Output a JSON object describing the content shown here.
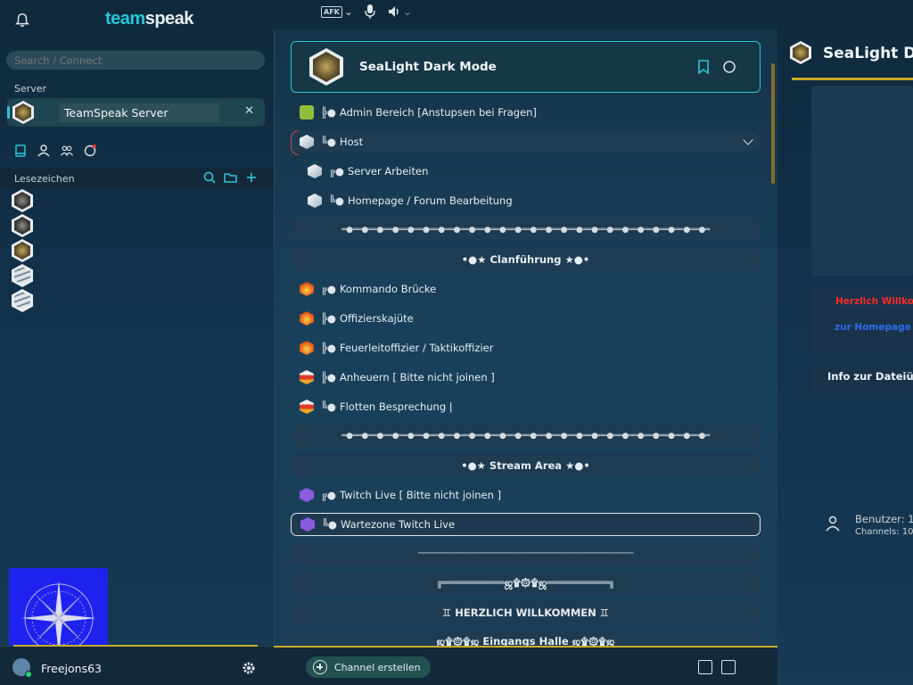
{
  "topbar": {
    "brand_part1": "team",
    "brand_part2": "speak",
    "afk_label": "AFK"
  },
  "sidebar": {
    "search_placeholder": "Search / Connect",
    "server_section_label": "Server",
    "active_server_name": "TeamSpeak Server",
    "bookmarks_label": "Lesezeichen",
    "bookmark_icons": [
      "server-logo",
      "server-logo",
      "server-logo-gold",
      "layers",
      "layers"
    ]
  },
  "user": {
    "nickname": "Freejons63",
    "status_color": "#25d366"
  },
  "server": {
    "title": "SeaLight Dark Mode",
    "accent_color": "#2ac6d8"
  },
  "channels": [
    {
      "icon": "help-badge",
      "prefix": "╠●",
      "name": "Admin Bereich [Anstupsen bei Fragen]"
    },
    {
      "icon": "cube",
      "prefix": "╚●",
      "name": "Host",
      "expanded": true
    },
    {
      "icon": "cube",
      "prefix": "╔●",
      "name": "Server Arbeiten",
      "sub": true
    },
    {
      "icon": "cube",
      "prefix": "╚●",
      "name": "Homepage / Forum Bearbeitung",
      "sub": true
    },
    {
      "spacer": "═●══●══●══●══●══●══●══●══●══●══●══●══●══●══●══●══●══●══●══●══●══●══●══●═"
    },
    {
      "header": "•●★ Clanführung ★●•"
    },
    {
      "icon": "fire",
      "prefix": "╔●",
      "name": "Kommando Brücke"
    },
    {
      "icon": "fire",
      "prefix": "╠●",
      "name": "Offizierskajüte"
    },
    {
      "icon": "fire",
      "prefix": "╠●",
      "name": "Feuerleitoffizier / Taktikoffizier"
    },
    {
      "icon": "flag",
      "prefix": "╠●",
      "name": "Anheuern  [ Bitte nicht joinen ]"
    },
    {
      "icon": "flag",
      "prefix": "╚●",
      "name": "Flotten Besprechung |"
    },
    {
      "spacer": "═●══●══●══●══●══●══●══●══●══●══●══●══●══●══●══●══●══●══●══●══●══●══●══●═"
    },
    {
      "header": "•●★ Stream Area ★●•"
    },
    {
      "icon": "twitch",
      "prefix": "╔●",
      "name": "Twitch Live [ Bitte nicht joinen ]"
    },
    {
      "icon": "twitch",
      "prefix": "╚●",
      "name": "Wartezone Twitch Live",
      "selected": true
    },
    {
      "spacer": "─────────────────────────────────────────────────"
    },
    {
      "header": "╔══════════ஜ۩۞۩ஜ══════════╗"
    },
    {
      "header": "♊ HERZLICH  WILLKOMMEN ♊"
    },
    {
      "header": "ஜ۩۞۩ஜ  Eingangs Halle  ஜ۩۞۩ஜ"
    }
  ],
  "bottom": {
    "create_channel_label": "Channel erstellen"
  },
  "right_panel": {
    "title": "SeaLight Da",
    "welcome_text": "Herzlich Willkom",
    "homepage_text": "zur Homepage au",
    "info_text": "Info zur Dateiübe",
    "users_label": "Benutzer: 1",
    "channels_label": "Channels: 10",
    "welcome_color": "#ff2a2a",
    "homepage_color": "#2e6cf2"
  }
}
